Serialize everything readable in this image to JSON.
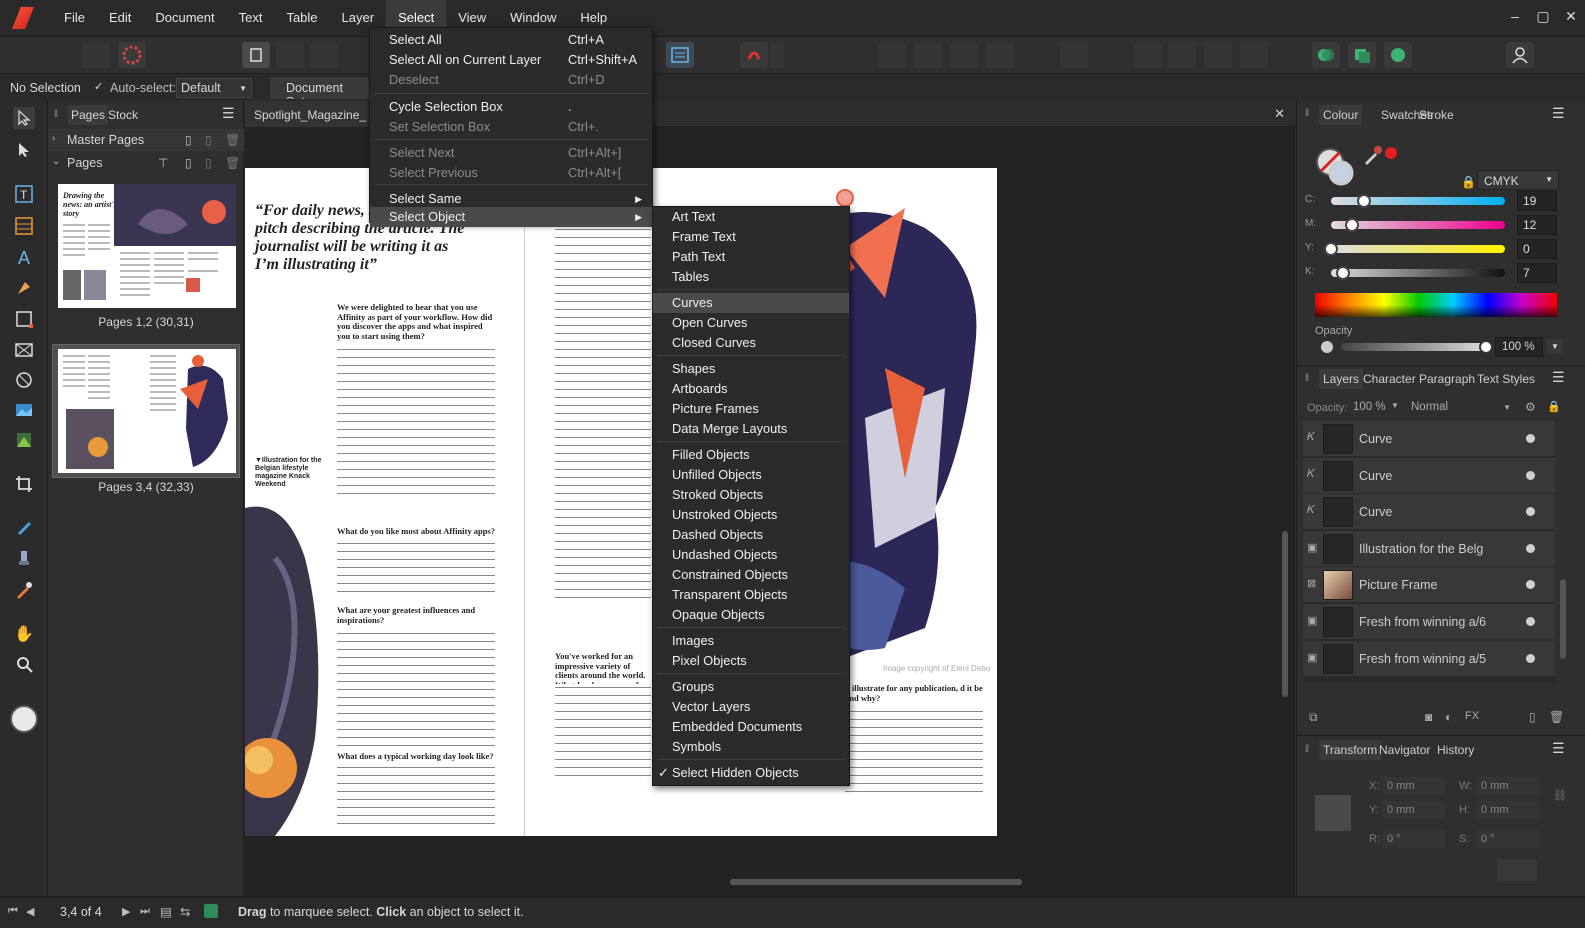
{
  "menubar": {
    "items": [
      "File",
      "Edit",
      "Document",
      "Text",
      "Table",
      "Layer",
      "Select",
      "View",
      "Window",
      "Help"
    ],
    "active": "Select"
  },
  "context": {
    "selection": "No Selection",
    "autoselect_label": "Auto-select:",
    "autoselect_value": "Default",
    "doc_setup": "Document Setu"
  },
  "pages_panel": {
    "tabs": [
      "Pages",
      "Stock"
    ],
    "master_pages": "Master Pages",
    "pages": "Pages",
    "spread1_label": "Pages 1,2 (30,31)",
    "spread2_label": "Pages 3,4 (32,33)"
  },
  "document": {
    "tab_title": "Spotlight_Magazine_Pro",
    "pullquote": "“For daily news, six-sentence pitch describing the article. The journalist will be writing it as I’m illustrating it”",
    "caption": "▼Illustration for the Belgian lifestyle magazine Knack Weekend",
    "q1": "We were delighted to hear that you use Affinity as part of your workflow. How did you discover the apps and what inspired you to start using them?",
    "q2": "What do you like most about Affinity apps?",
    "q3": "What are your greatest influences and inspirations?",
    "q4": "What does a typical working day look like?",
    "q5": "You've worked for an impressive variety of clients around the world. What has been some of your favourite",
    "q6": "d illustrate for any publication, d it be and why?",
    "copyright": "Image copyright of Eleni Debo"
  },
  "select_menu": {
    "items": [
      {
        "label": "Select All",
        "shortcut": "Ctrl+A",
        "disabled": false
      },
      {
        "label": "Select All on Current Layer",
        "shortcut": "Ctrl+Shift+A",
        "disabled": false
      },
      {
        "label": "Deselect",
        "shortcut": "Ctrl+D",
        "disabled": true
      },
      {
        "label": "Cycle Selection Box",
        "shortcut": ".",
        "disabled": false
      },
      {
        "label": "Set Selection Box",
        "shortcut": "Ctrl+.",
        "disabled": true
      },
      {
        "label": "Select Next",
        "shortcut": "Ctrl+Alt+]",
        "disabled": true
      },
      {
        "label": "Select Previous",
        "shortcut": "Ctrl+Alt+[",
        "disabled": true
      },
      {
        "label": "Select Same",
        "shortcut": "",
        "disabled": false
      },
      {
        "label": "Select Object",
        "shortcut": "",
        "disabled": false
      }
    ]
  },
  "select_object_submenu": {
    "items": [
      "Art Text",
      "Frame Text",
      "Path Text",
      "Tables",
      "Curves",
      "Open Curves",
      "Closed Curves",
      "Shapes",
      "Artboards",
      "Picture Frames",
      "Data Merge Layouts",
      "Filled Objects",
      "Unfilled Objects",
      "Stroked Objects",
      "Unstroked Objects",
      "Dashed Objects",
      "Undashed Objects",
      "Constrained Objects",
      "Transparent Objects",
      "Opaque Objects",
      "Images",
      "Pixel Objects",
      "Groups",
      "Vector Layers",
      "Embedded Documents",
      "Symbols",
      "Select Hidden Objects"
    ],
    "highlighted": "Curves",
    "checked": "Select Hidden Objects"
  },
  "colour_panel": {
    "tabs": [
      "Colour",
      "Swatches",
      "Stroke"
    ],
    "model": "CMYK",
    "channels": [
      {
        "name": "C:",
        "value": 19,
        "color": "#00aeef"
      },
      {
        "name": "M:",
        "value": 12,
        "color": "#ec008c"
      },
      {
        "name": "Y:",
        "value": 0,
        "color": "#fff200"
      },
      {
        "name": "K:",
        "value": 7,
        "color": "#000000"
      }
    ],
    "opacity_label": "Opacity",
    "opacity_value": "100 %"
  },
  "layers_panel": {
    "tabs": [
      "Layers",
      "Character",
      "Paragraph",
      "Text Styles"
    ],
    "opacity_label": "Opacity:",
    "opacity_value": "100 %",
    "blend_mode": "Normal",
    "layers": [
      "Curve",
      "Curve",
      "Curve",
      "Illustration for the Belg",
      "Picture Frame",
      "Fresh from winning a/6",
      "Fresh from winning a/5"
    ]
  },
  "transform_panel": {
    "tabs": [
      "Transform",
      "Navigator",
      "History"
    ],
    "x": "0 mm",
    "y": "0 mm",
    "w": "0 mm",
    "h": "0 mm",
    "r": "0 °",
    "s": "0 °",
    "labels": {
      "x": "X:",
      "y": "Y:",
      "w": "W:",
      "h": "H:",
      "r": "R:",
      "s": "S:"
    }
  },
  "status": {
    "page_counter": "3,4 of 4",
    "hint_drag": "Drag",
    "hint_mid": " to marquee select. ",
    "hint_click": "Click",
    "hint_end": " an object to select it."
  }
}
